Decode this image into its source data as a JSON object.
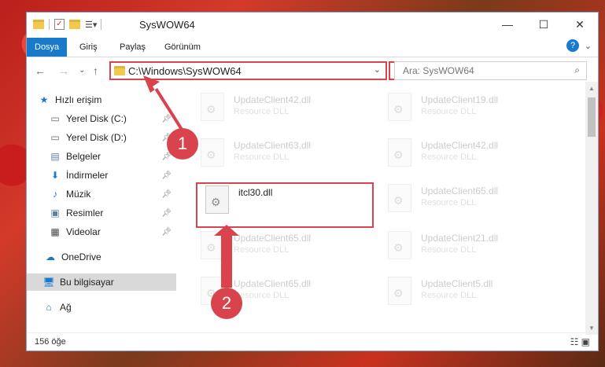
{
  "window": {
    "title": "SysWOW64",
    "minimize": "—",
    "maximize": "☐",
    "close": "✕"
  },
  "ribbon": {
    "tabs": [
      "Dosya",
      "Giriş",
      "Paylaş",
      "Görünüm"
    ],
    "expand": "⌄",
    "help": "?"
  },
  "nav": {
    "back": "←",
    "forward": "→",
    "recent": "⌄",
    "up": "↑",
    "address": "C:\\Windows\\SysWOW64",
    "address_dropdown": "⌄",
    "refresh": "↻",
    "search_placeholder": "Ara: SysWOW64",
    "search_icon": "⌕"
  },
  "sidebar": {
    "items": [
      {
        "label": "Hızlı erişim",
        "icon": "star-icon"
      },
      {
        "label": "Yerel Disk (C:)",
        "icon": "drive-icon"
      },
      {
        "label": "Yerel Disk (D:)",
        "icon": "drive-icon"
      },
      {
        "label": "Belgeler",
        "icon": "documents-icon"
      },
      {
        "label": "İndirmeler",
        "icon": "download-icon"
      },
      {
        "label": "Müzik",
        "icon": "music-icon"
      },
      {
        "label": "Resimler",
        "icon": "pictures-icon"
      },
      {
        "label": "Videolar",
        "icon": "videos-icon"
      },
      {
        "label": "OneDrive",
        "icon": "cloud-icon"
      },
      {
        "label": "Bu bilgisayar",
        "icon": "computer-icon"
      },
      {
        "label": "Ağ",
        "icon": "network-icon"
      }
    ]
  },
  "files": [
    {
      "name": "UpdateClient42.dll",
      "type": "Resource DLL"
    },
    {
      "name": "UpdateClient19.dll",
      "type": "Resource DLL"
    },
    {
      "name": "UpdateClient63.dll",
      "type": "Resource DLL"
    },
    {
      "name": "UpdateClient42.dll",
      "type": "Resource DLL"
    },
    {
      "name": "itcl30.dll",
      "type": ""
    },
    {
      "name": "UpdateClient65.dll",
      "type": "Resource DLL"
    },
    {
      "name": "UpdateClient65.dll",
      "type": "Resource DLL"
    },
    {
      "name": "UpdateClient21.dll",
      "type": "Resource DLL"
    },
    {
      "name": "UpdateClient65.dll",
      "type": "Resource DLL"
    },
    {
      "name": "UpdateClient5.dll",
      "type": "Resource DLL"
    }
  ],
  "status": {
    "count": "156 öğe"
  },
  "callouts": [
    "1",
    "2"
  ],
  "colors": {
    "accent": "#1979ca",
    "highlight": "#d9434d"
  }
}
